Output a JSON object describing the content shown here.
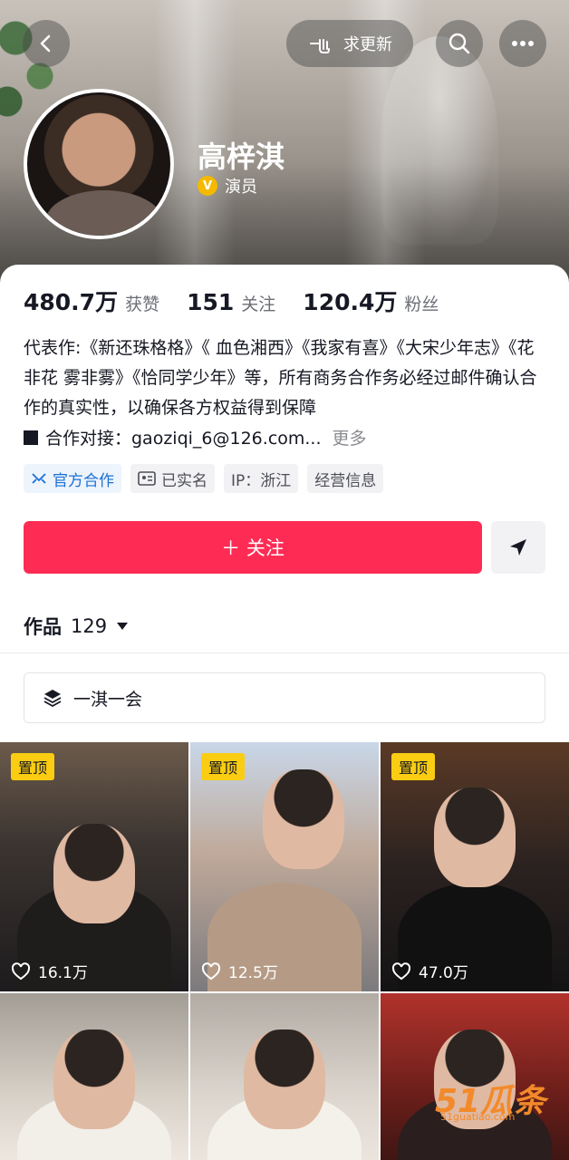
{
  "header": {
    "update_request_label": "求更新",
    "icons": {
      "back": "chevron-left-icon",
      "update": "pointing-hand-icon",
      "search": "search-icon",
      "more": "more-icon"
    }
  },
  "profile": {
    "name": "高梓淇",
    "verify_label": "演员",
    "verify_color": "#f5b900"
  },
  "stats": [
    {
      "num": "480.7万",
      "label": "获赞"
    },
    {
      "num": "151",
      "label": "关注"
    },
    {
      "num": "120.4万",
      "label": "粉丝"
    }
  ],
  "bio": {
    "text": "代表作:《新还珠格格》《 血色湘西》《我家有喜》《大宋少年志》《花非花 雾非雾》《恰同学少年》等，所有商务合作务必经过邮件确认合作的真实性，以确保各方权益得到保障",
    "contact": "合作对接：gaoziqi_6@126.com...",
    "more": "更多"
  },
  "tags": [
    "官方合作",
    "已实名",
    "IP：浙江",
    "经营信息"
  ],
  "actions": {
    "follow_label": "＋ 关注",
    "follow_color": "#fe2c55"
  },
  "works": {
    "label": "作品",
    "count": "129"
  },
  "collection": {
    "label": "一淇一会"
  },
  "videos": [
    {
      "pinned": "置顶",
      "likes": "16.1万"
    },
    {
      "pinned": "置顶",
      "likes": "12.5万"
    },
    {
      "pinned": "置顶",
      "likes": "47.0万"
    },
    {
      "pinned": "",
      "likes": ""
    },
    {
      "pinned": "",
      "likes": ""
    },
    {
      "pinned": "",
      "likes": ""
    }
  ],
  "watermark": {
    "brand": "51瓜条",
    "url": "51guatiao.com"
  }
}
